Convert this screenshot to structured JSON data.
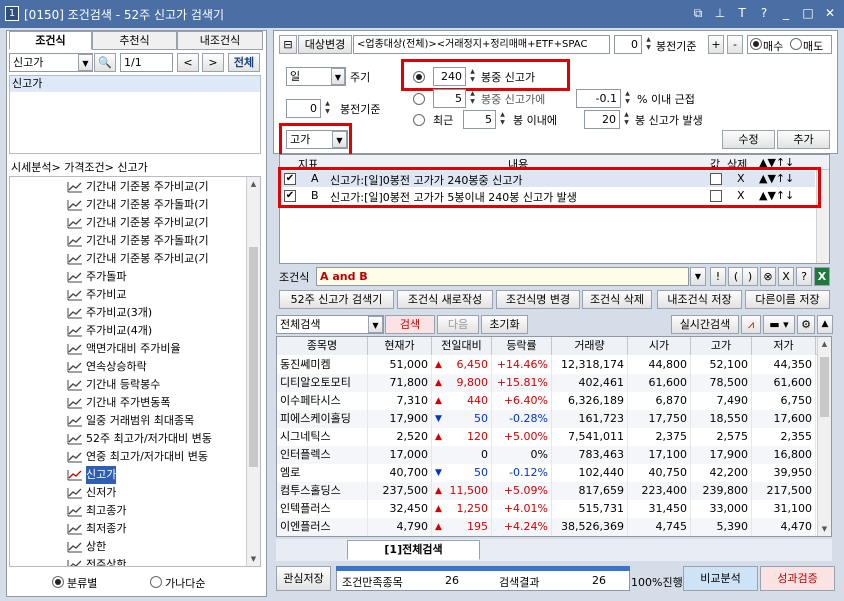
{
  "window": {
    "number": "1",
    "title": "[0150] 조건검색 - 52주 신고가 검색기"
  },
  "left": {
    "tabs": [
      "조건식",
      "추천식",
      "내조건식"
    ],
    "search_value": "신고가",
    "page_value": "1/1",
    "all_label": "전체",
    "results": [
      "신고가"
    ],
    "breadcrumb": "시세분석> 가격조건> 신고가",
    "tree": [
      "기간내 기준봉 주가비교(기",
      "기간내 기준봉 주가돌파(기",
      "기간내 기준봉 주가비교(기",
      "기간내 기준봉 주가돌파(기",
      "기간내 기준봉 주가비교(기",
      "주가돌파",
      "주가비교",
      "주가비교(3개)",
      "주가비교(4개)",
      "액면가대비 주가비율",
      "연속상승하락",
      "기간내 등락봉수",
      "기간내 주가변동폭",
      "일중 거래범위 최대종목",
      "52주 최고가/저가대비 변동",
      "연중 최고가/저가대비 변동",
      "신고가",
      "신저가",
      "최고종가",
      "최저종가",
      "상한",
      "전주상한"
    ],
    "selected_tree_index": 16,
    "radio_category": "분류별",
    "radio_alpha": "가나다순"
  },
  "right": {
    "target_change_label": "대상변경",
    "target_desc": "<업종대상(전체)><거래정지+정리매매+ETF+SPAC",
    "bong_value": "0",
    "bong_label": "봉전기준",
    "plus": "+",
    "minus": "-",
    "buy_label": "매수",
    "sell_label": "매도",
    "period_value": "일",
    "period_label": "주기",
    "base_value": "0",
    "base_label": "봉전기준",
    "opt1_value": "240",
    "opt1_label": "봉중 신고가",
    "opt2_value": "5",
    "opt2_label": "봉중 신고가에",
    "opt2_pct": "-0.1",
    "opt2_suffix": "% 이내 근접",
    "opt3_prefix": "최근",
    "opt3_value": "5",
    "opt3_mid": "봉 이내에",
    "opt3_value2": "20",
    "opt3_suffix": "봉 신고가 발생",
    "type_value": "고가",
    "edit_label": "수정",
    "add_label": "추가",
    "cond_headers": [
      "지표",
      "내용",
      "값",
      "삭제",
      "▲▼↑↓"
    ],
    "conditions": [
      {
        "id": "A",
        "text": "신고가:[일]0봉전 고가가 240봉중 신고가",
        "del": "X"
      },
      {
        "id": "B",
        "text": "신고가:[일]0봉전 고가가 5봉이내 240봉 신고가 발생",
        "del": "X"
      }
    ],
    "formula_label": "조건식",
    "formula_value": "A and B",
    "formula_buttons": [
      "!",
      "(",
      ")",
      "⊗",
      "X",
      "?"
    ],
    "action_buttons": [
      "52주 신고가 검색기",
      "조건식 새로작성",
      "조건식명 변경",
      "조건식 삭제",
      "내조건식 저장",
      "다른이름 저장"
    ],
    "scope_value": "전체검색",
    "search_label": "검색",
    "next_label": "다음",
    "reset_label": "초기화",
    "realtime_label": "실시간검색"
  },
  "grid": {
    "headers": [
      "종목명",
      "현재가",
      "전일대비",
      "등락률",
      "거래량",
      "시가",
      "고가",
      "저가"
    ],
    "rows": [
      {
        "name": "동진쎄미켐",
        "price": "51,000",
        "dir": "up",
        "chg": "6,450",
        "rate": "+14.46%",
        "vol": "12,318,174",
        "open": "44,800",
        "high": "52,100",
        "low": "44,350"
      },
      {
        "name": "디티알오토모티",
        "price": "71,800",
        "dir": "up",
        "chg": "9,800",
        "rate": "+15.81%",
        "vol": "402,461",
        "open": "61,600",
        "high": "78,500",
        "low": "61,600"
      },
      {
        "name": "이수페타시스",
        "price": "7,310",
        "dir": "up",
        "chg": "440",
        "rate": "+6.40%",
        "vol": "6,326,189",
        "open": "6,870",
        "high": "7,490",
        "low": "6,750"
      },
      {
        "name": "피에스케이홀딩",
        "price": "17,900",
        "dir": "dn",
        "chg": "50",
        "rate": "-0.28%",
        "vol": "161,723",
        "open": "17,750",
        "high": "18,550",
        "low": "17,600"
      },
      {
        "name": "시그네틱스",
        "price": "2,520",
        "dir": "up",
        "chg": "120",
        "rate": "+5.00%",
        "vol": "7,541,011",
        "open": "2,375",
        "high": "2,575",
        "low": "2,355"
      },
      {
        "name": "인터플렉스",
        "price": "17,000",
        "dir": "none",
        "chg": "0",
        "rate": "0%",
        "vol": "783,463",
        "open": "17,100",
        "high": "17,900",
        "low": "16,800"
      },
      {
        "name": "엠로",
        "price": "40,700",
        "dir": "dn",
        "chg": "50",
        "rate": "-0.12%",
        "vol": "102,440",
        "open": "40,750",
        "high": "42,200",
        "low": "39,950"
      },
      {
        "name": "컴투스홀딩스",
        "price": "237,500",
        "dir": "up",
        "chg": "11,500",
        "rate": "+5.09%",
        "vol": "817,659",
        "open": "223,400",
        "high": "239,800",
        "low": "217,500"
      },
      {
        "name": "인텍플러스",
        "price": "32,450",
        "dir": "up",
        "chg": "1,250",
        "rate": "+4.01%",
        "vol": "515,731",
        "open": "31,450",
        "high": "33,000",
        "low": "31,100"
      },
      {
        "name": "이엔플러스",
        "price": "4,790",
        "dir": "up",
        "chg": "195",
        "rate": "+4.24%",
        "vol": "38,526,369",
        "open": "4,745",
        "high": "5,390",
        "low": "4,470"
      }
    ],
    "bottom_tab": "[1]전체검색"
  },
  "status": {
    "save_label": "관심저장",
    "match_label": "조건만족종목",
    "match_value": "26",
    "result_label": "검색결과",
    "result_value": "26",
    "progress_label": "100%진행",
    "progress": 1.0,
    "compare_label": "비교분석",
    "perf_label": "성과검증"
  },
  "colors": {
    "titlebar": "#4a6fa5",
    "up": "#d40000",
    "down": "#0033cc",
    "highlight": "#e00000"
  }
}
